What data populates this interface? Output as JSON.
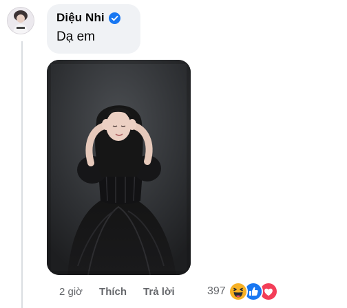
{
  "comment": {
    "author": "Diệu Nhi",
    "verified": true,
    "text": "Dạ em",
    "avatar_icon": "profile-avatar-icon",
    "photo": "photo-woman-black-gown"
  },
  "actions": {
    "time": "2 giờ",
    "like_label": "Thích",
    "reply_label": "Trả lời"
  },
  "reactions": {
    "count": "397",
    "icons": [
      "haha-icon",
      "like-icon",
      "love-icon"
    ]
  },
  "colors": {
    "bubble": "#f0f2f5",
    "text": "#050505",
    "meta": "#65676b",
    "verified": "#1877f2",
    "like": "#1877f2",
    "love": "#f33e58",
    "haha": "#f7b125"
  }
}
